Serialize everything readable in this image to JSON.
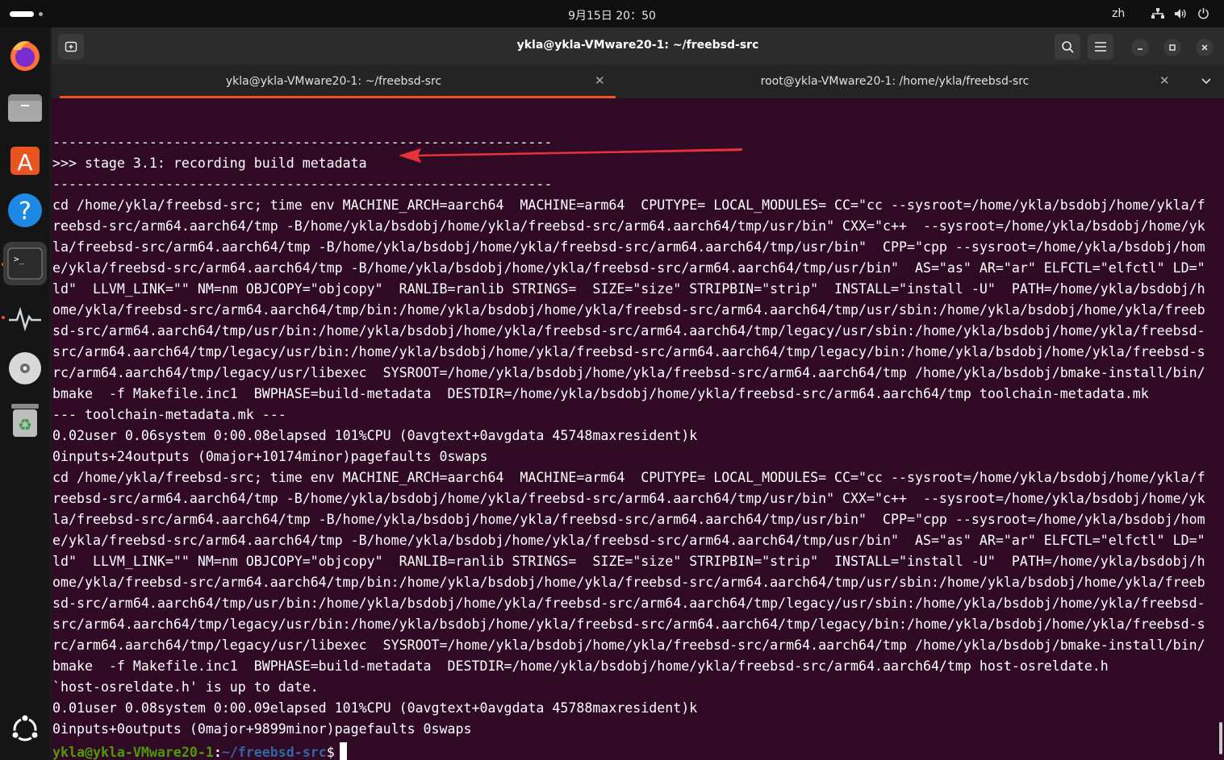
{
  "topbar": {
    "datetime": "9月15日 20：50",
    "lang": "zh"
  },
  "window": {
    "title": "ykla@ykla-VMware20-1: ~/freebsd-src",
    "tabs": [
      {
        "label": "ykla@ykla-VMware20-1: ~/freebsd-src"
      },
      {
        "label": "root@ykla-VMware20-1: /home/ykla/freebsd-src"
      }
    ]
  },
  "dock": [
    "firefox-icon",
    "files-icon",
    "app-center-icon",
    "help-icon",
    "terminal-icon",
    "system-monitor-icon",
    "disc-icon",
    "trash-icon",
    "show-apps-icon"
  ],
  "terminal": {
    "lines": [
      "--------------------------------------------------------------",
      ">>> stage 3.1: recording build metadata",
      "--------------------------------------------------------------",
      "cd /home/ykla/freebsd-src; time env MACHINE_ARCH=aarch64  MACHINE=arm64  CPUTYPE= LOCAL_MODULES= CC=\"cc --sysroot=/home/ykla/bsdobj/home/ykla/f",
      "reebsd-src/arm64.aarch64/tmp -B/home/ykla/bsdobj/home/ykla/freebsd-src/arm64.aarch64/tmp/usr/bin\" CXX=\"c++  --sysroot=/home/ykla/bsdobj/home/yk",
      "la/freebsd-src/arm64.aarch64/tmp -B/home/ykla/bsdobj/home/ykla/freebsd-src/arm64.aarch64/tmp/usr/bin\"  CPP=\"cpp --sysroot=/home/ykla/bsdobj/hom",
      "e/ykla/freebsd-src/arm64.aarch64/tmp -B/home/ykla/bsdobj/home/ykla/freebsd-src/arm64.aarch64/tmp/usr/bin\"  AS=\"as\" AR=\"ar\" ELFCTL=\"elfctl\" LD=\"",
      "ld\"  LLVM_LINK=\"\" NM=nm OBJCOPY=\"objcopy\"  RANLIB=ranlib STRINGS=  SIZE=\"size\" STRIPBIN=\"strip\"  INSTALL=\"install -U\"  PATH=/home/ykla/bsdobj/h",
      "ome/ykla/freebsd-src/arm64.aarch64/tmp/bin:/home/ykla/bsdobj/home/ykla/freebsd-src/arm64.aarch64/tmp/usr/sbin:/home/ykla/bsdobj/home/ykla/freeb",
      "sd-src/arm64.aarch64/tmp/usr/bin:/home/ykla/bsdobj/home/ykla/freebsd-src/arm64.aarch64/tmp/legacy/usr/sbin:/home/ykla/bsdobj/home/ykla/freebsd-",
      "src/arm64.aarch64/tmp/legacy/usr/bin:/home/ykla/bsdobj/home/ykla/freebsd-src/arm64.aarch64/tmp/legacy/bin:/home/ykla/bsdobj/home/ykla/freebsd-s",
      "rc/arm64.aarch64/tmp/legacy/usr/libexec  SYSROOT=/home/ykla/bsdobj/home/ykla/freebsd-src/arm64.aarch64/tmp /home/ykla/bsdobj/bmake-install/bin/",
      "bmake  -f Makefile.inc1  BWPHASE=build-metadata  DESTDIR=/home/ykla/bsdobj/home/ykla/freebsd-src/arm64.aarch64/tmp toolchain-metadata.mk",
      "--- toolchain-metadata.mk ---",
      "0.02user 0.06system 0:00.08elapsed 101%CPU (0avgtext+0avgdata 45748maxresident)k",
      "0inputs+24outputs (0major+10174minor)pagefaults 0swaps",
      "cd /home/ykla/freebsd-src; time env MACHINE_ARCH=aarch64  MACHINE=arm64  CPUTYPE= LOCAL_MODULES= CC=\"cc --sysroot=/home/ykla/bsdobj/home/ykla/f",
      "reebsd-src/arm64.aarch64/tmp -B/home/ykla/bsdobj/home/ykla/freebsd-src/arm64.aarch64/tmp/usr/bin\" CXX=\"c++  --sysroot=/home/ykla/bsdobj/home/yk",
      "la/freebsd-src/arm64.aarch64/tmp -B/home/ykla/bsdobj/home/ykla/freebsd-src/arm64.aarch64/tmp/usr/bin\"  CPP=\"cpp --sysroot=/home/ykla/bsdobj/hom",
      "e/ykla/freebsd-src/arm64.aarch64/tmp -B/home/ykla/bsdobj/home/ykla/freebsd-src/arm64.aarch64/tmp/usr/bin\"  AS=\"as\" AR=\"ar\" ELFCTL=\"elfctl\" LD=\"",
      "ld\"  LLVM_LINK=\"\" NM=nm OBJCOPY=\"objcopy\"  RANLIB=ranlib STRINGS=  SIZE=\"size\" STRIPBIN=\"strip\"  INSTALL=\"install -U\"  PATH=/home/ykla/bsdobj/h",
      "ome/ykla/freebsd-src/arm64.aarch64/tmp/bin:/home/ykla/bsdobj/home/ykla/freebsd-src/arm64.aarch64/tmp/usr/sbin:/home/ykla/bsdobj/home/ykla/freeb",
      "sd-src/arm64.aarch64/tmp/usr/bin:/home/ykla/bsdobj/home/ykla/freebsd-src/arm64.aarch64/tmp/legacy/usr/sbin:/home/ykla/bsdobj/home/ykla/freebsd-",
      "src/arm64.aarch64/tmp/legacy/usr/bin:/home/ykla/bsdobj/home/ykla/freebsd-src/arm64.aarch64/tmp/legacy/bin:/home/ykla/bsdobj/home/ykla/freebsd-s",
      "rc/arm64.aarch64/tmp/legacy/usr/libexec  SYSROOT=/home/ykla/bsdobj/home/ykla/freebsd-src/arm64.aarch64/tmp /home/ykla/bsdobj/bmake-install/bin/",
      "bmake  -f Makefile.inc1  BWPHASE=build-metadata  DESTDIR=/home/ykla/bsdobj/home/ykla/freebsd-src/arm64.aarch64/tmp host-osreldate.h",
      "`host-osreldate.h' is up to date.",
      "0.01user 0.08system 0:00.09elapsed 101%CPU (0avgtext+0avgdata 45788maxresident)k",
      "0inputs+0outputs (0major+9899minor)pagefaults 0swaps"
    ],
    "prompt": {
      "user": "ykla@ykla-VMware20-1",
      "sep": ":",
      "path": "~/freebsd-src",
      "sym": "$"
    }
  },
  "colors": {
    "accent": "#e95420",
    "arrow": "#e8323a",
    "bg": "#300a24"
  }
}
